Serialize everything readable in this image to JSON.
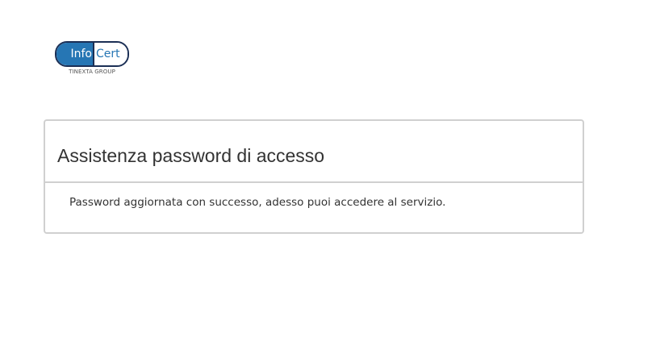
{
  "logo": {
    "left_text": "Info",
    "right_text": "Cert",
    "tagline": "TINEXTA GROUP",
    "colors": {
      "primary": "#2676b4",
      "outline": "#1b2f55"
    }
  },
  "panel": {
    "title": "Assistenza password di accesso",
    "message": "Password aggiornata con successo, adesso puoi accedere al servizio.",
    "border_color": "#d0d0d0"
  }
}
